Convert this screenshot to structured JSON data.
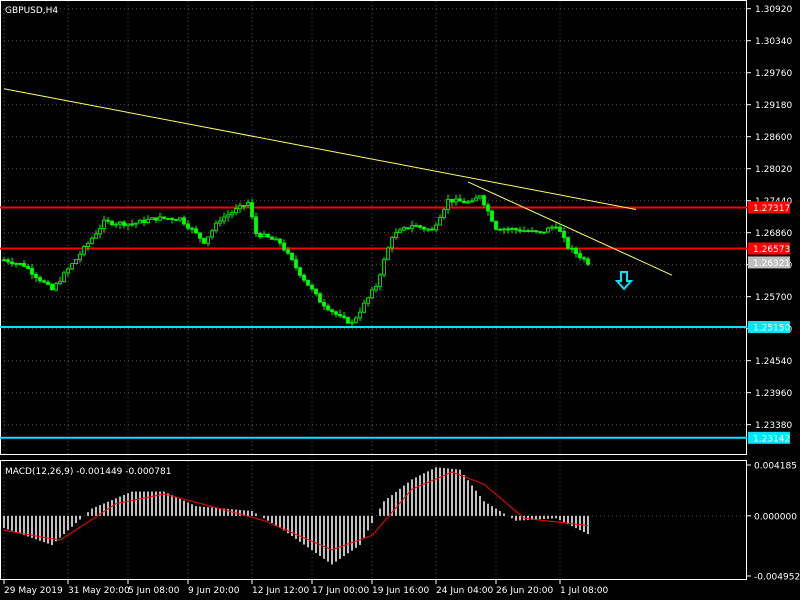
{
  "symbol_label": "GBPUSD,H4",
  "macd_label": "MACD(12,26,9) -0.001449 -0.000781",
  "colors": {
    "background": "#000000",
    "grid": "#8c8c8c",
    "bull": "#00ff00",
    "bear": "#00ff00",
    "support_resistance": "#ff0000",
    "target_lines": "#00e5ff",
    "trendline": "#ffff66",
    "macd_hist": "#c0c0c0",
    "macd_signal": "#ff0000",
    "arrow": "#00e5ff"
  },
  "price_axis": {
    "ticks": [
      "1.30920",
      "1.30340",
      "1.29760",
      "1.29180",
      "1.28600",
      "1.28020",
      "1.27440",
      "1.26860",
      "1.26280",
      "1.25700",
      "1.25120",
      "1.24540",
      "1.23960",
      "1.23380"
    ],
    "tick_values": [
      1.3092,
      1.3034,
      1.2976,
      1.2918,
      1.286,
      1.2802,
      1.2744,
      1.2686,
      1.2628,
      1.257,
      1.2512,
      1.2454,
      1.2396,
      1.2338
    ]
  },
  "time_axis": {
    "labels": [
      "29 May 2019",
      "31 May 20:00",
      "5 Jun 08:00",
      "9 Jun 20:00",
      "12 Jun 12:00",
      "17 Jun 00:00",
      "19 Jun 16:00",
      "24 Jun 04:00",
      "26 Jun 20:00",
      "1 Jul 08:00"
    ],
    "bar_index": [
      0,
      16,
      31,
      46,
      62,
      77,
      92,
      108,
      123,
      139
    ]
  },
  "horizontal_levels": [
    {
      "price": 1.27317,
      "label": "1.27317",
      "kind": "resistance"
    },
    {
      "price": 1.26573,
      "label": "1.26573",
      "kind": "resistance"
    },
    {
      "price": 1.2515,
      "label": "1.25150",
      "kind": "target"
    },
    {
      "price": 1.23142,
      "label": "1.23142",
      "kind": "target"
    }
  ],
  "current_price": {
    "price": 1.26321,
    "label": "1.26321"
  },
  "macd_axis": {
    "ticks": [
      "0.004185",
      "0.000000",
      "-0.004952"
    ],
    "tick_values": [
      0.004185,
      0.0,
      -0.004952
    ]
  },
  "chart_data": {
    "type": "candlestick",
    "symbol": "GBPUSD",
    "timeframe": "H4",
    "ylim": [
      1.2283,
      1.3106
    ],
    "close_waypoints": [
      {
        "bar": 0,
        "close": 1.2637
      },
      {
        "bar": 5,
        "close": 1.2627
      },
      {
        "bar": 12,
        "close": 1.2582
      },
      {
        "bar": 18,
        "close": 1.2638
      },
      {
        "bar": 25,
        "close": 1.2705
      },
      {
        "bar": 32,
        "close": 1.2702
      },
      {
        "bar": 38,
        "close": 1.2712
      },
      {
        "bar": 44,
        "close": 1.2712
      },
      {
        "bar": 50,
        "close": 1.267
      },
      {
        "bar": 54,
        "close": 1.271
      },
      {
        "bar": 61,
        "close": 1.274
      },
      {
        "bar": 63,
        "close": 1.2685
      },
      {
        "bar": 69,
        "close": 1.2668
      },
      {
        "bar": 74,
        "close": 1.2612
      },
      {
        "bar": 79,
        "close": 1.2562
      },
      {
        "bar": 84,
        "close": 1.2532
      },
      {
        "bar": 87,
        "close": 1.2522
      },
      {
        "bar": 93,
        "close": 1.259
      },
      {
        "bar": 97,
        "close": 1.268
      },
      {
        "bar": 102,
        "close": 1.27
      },
      {
        "bar": 107,
        "close": 1.269
      },
      {
        "bar": 111,
        "close": 1.2745
      },
      {
        "bar": 117,
        "close": 1.274
      },
      {
        "bar": 119,
        "close": 1.2755
      },
      {
        "bar": 123,
        "close": 1.2695
      },
      {
        "bar": 130,
        "close": 1.269
      },
      {
        "bar": 134,
        "close": 1.2685
      },
      {
        "bar": 138,
        "close": 1.27
      },
      {
        "bar": 141,
        "close": 1.266
      },
      {
        "bar": 146,
        "close": 1.2632
      }
    ],
    "trendlines": [
      {
        "from": {
          "bar": 0,
          "price": 1.2947
        },
        "to": {
          "bar": 158,
          "price": 1.2728
        }
      },
      {
        "from": {
          "bar": 116,
          "price": 1.2778
        },
        "to": {
          "bar": 167,
          "price": 1.2609
        }
      }
    ],
    "signal_arrow": {
      "direction": "down",
      "bar": 155,
      "price": 1.2593
    },
    "macd": {
      "params": "12,26,9",
      "main": -0.001449,
      "signal": -0.000781,
      "hist_waypoints": [
        {
          "bar": 0,
          "value": -0.001
        },
        {
          "bar": 12,
          "value": -0.0024
        },
        {
          "bar": 22,
          "value": 0.0006
        },
        {
          "bar": 32,
          "value": 0.002
        },
        {
          "bar": 40,
          "value": 0.002
        },
        {
          "bar": 48,
          "value": 0.0008
        },
        {
          "bar": 55,
          "value": 0.0006
        },
        {
          "bar": 62,
          "value": 0.0004
        },
        {
          "bar": 70,
          "value": -0.0012
        },
        {
          "bar": 82,
          "value": -0.004
        },
        {
          "bar": 89,
          "value": -0.0024
        },
        {
          "bar": 95,
          "value": 0.0012
        },
        {
          "bar": 102,
          "value": 0.003
        },
        {
          "bar": 108,
          "value": 0.004
        },
        {
          "bar": 114,
          "value": 0.0038
        },
        {
          "bar": 120,
          "value": 0.0012
        },
        {
          "bar": 128,
          "value": -0.0004
        },
        {
          "bar": 138,
          "value": -0.0002
        },
        {
          "bar": 146,
          "value": -0.0015
        }
      ],
      "signal_waypoints": [
        {
          "bar": 0,
          "value": -0.0012
        },
        {
          "bar": 14,
          "value": -0.002
        },
        {
          "bar": 28,
          "value": 0.001
        },
        {
          "bar": 40,
          "value": 0.0018
        },
        {
          "bar": 55,
          "value": 0.0005
        },
        {
          "bar": 65,
          "value": -0.0004
        },
        {
          "bar": 82,
          "value": -0.0028
        },
        {
          "bar": 92,
          "value": -0.0016
        },
        {
          "bar": 102,
          "value": 0.0022
        },
        {
          "bar": 112,
          "value": 0.0036
        },
        {
          "bar": 120,
          "value": 0.0026
        },
        {
          "bar": 130,
          "value": -0.0002
        },
        {
          "bar": 146,
          "value": -0.0008
        }
      ]
    }
  }
}
